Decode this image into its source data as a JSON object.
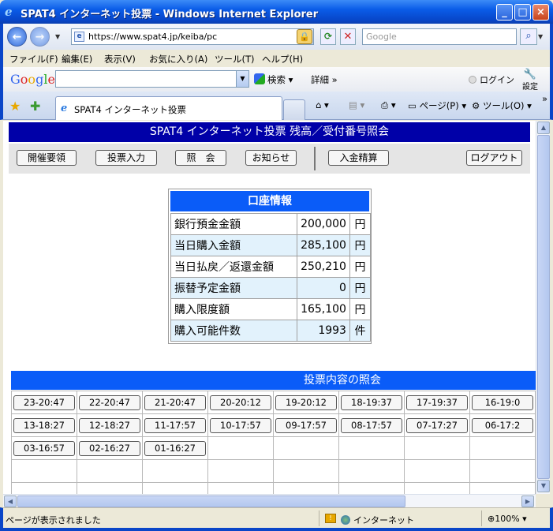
{
  "window": {
    "title": "SPAT4 インターネット投票 - Windows Internet Explorer",
    "minimize": "_",
    "maximize": "□",
    "close": "×"
  },
  "address": {
    "url": "https://www.spat4.jp/keiba/pc",
    "search_placeholder": "Google"
  },
  "menu": [
    "ファイル(F)",
    "編集(E)",
    "表示(V)",
    "お気に入り(A)",
    "ツール(T)",
    "ヘルプ(H)"
  ],
  "google_toolbar": {
    "search_label": "検索",
    "detail_label": "詳細 »",
    "login_label": "ログイン",
    "settings_label": "設定"
  },
  "tabs": {
    "active_tab": "SPAT4 インターネット投票",
    "page_menu": "ページ(P)",
    "tools_menu": "ツール(O)"
  },
  "page": {
    "header": "SPAT4 インターネット投票 残高／受付番号照会",
    "nav": {
      "guide": "開催要領",
      "bet_input": "投票入力",
      "inquiry": "照　会",
      "news": "お知らせ",
      "deposit": "入金精算",
      "logout": "ログアウト"
    }
  },
  "account": {
    "title": "口座情報",
    "rows": [
      {
        "label": "銀行預金金額",
        "value": "200,000",
        "unit": "円"
      },
      {
        "label": "当日購入金額",
        "value": "285,100",
        "unit": "円"
      },
      {
        "label": "当日払戻／返還金額",
        "value": "250,210",
        "unit": "円"
      },
      {
        "label": "振替予定金額",
        "value": "0",
        "unit": "円"
      },
      {
        "label": "購入限度額",
        "value": "165,100",
        "unit": "円"
      },
      {
        "label": "購入可能件数",
        "value": "1993",
        "unit": "件"
      }
    ]
  },
  "bets": {
    "title": "投票内容の照会",
    "rows": [
      [
        "23-20:47",
        "22-20:47",
        "21-20:47",
        "20-20:12",
        "19-20:12",
        "18-19:37",
        "17-19:37",
        "16-19:0"
      ],
      [
        "13-18:27",
        "12-18:27",
        "11-17:57",
        "10-17:57",
        "09-17:57",
        "08-17:57",
        "07-17:27",
        "06-17:2"
      ],
      [
        "03-16:57",
        "02-16:27",
        "01-16:27",
        "",
        "",
        "",
        "",
        ""
      ],
      [
        "",
        "",
        "",
        "",
        "",
        "",
        "",
        ""
      ],
      [
        "",
        "",
        "",
        "",
        "",
        "",
        "",
        ""
      ]
    ]
  },
  "status": {
    "message": "ページが表示されました",
    "zone": "インターネット",
    "zoom": "100%"
  }
}
